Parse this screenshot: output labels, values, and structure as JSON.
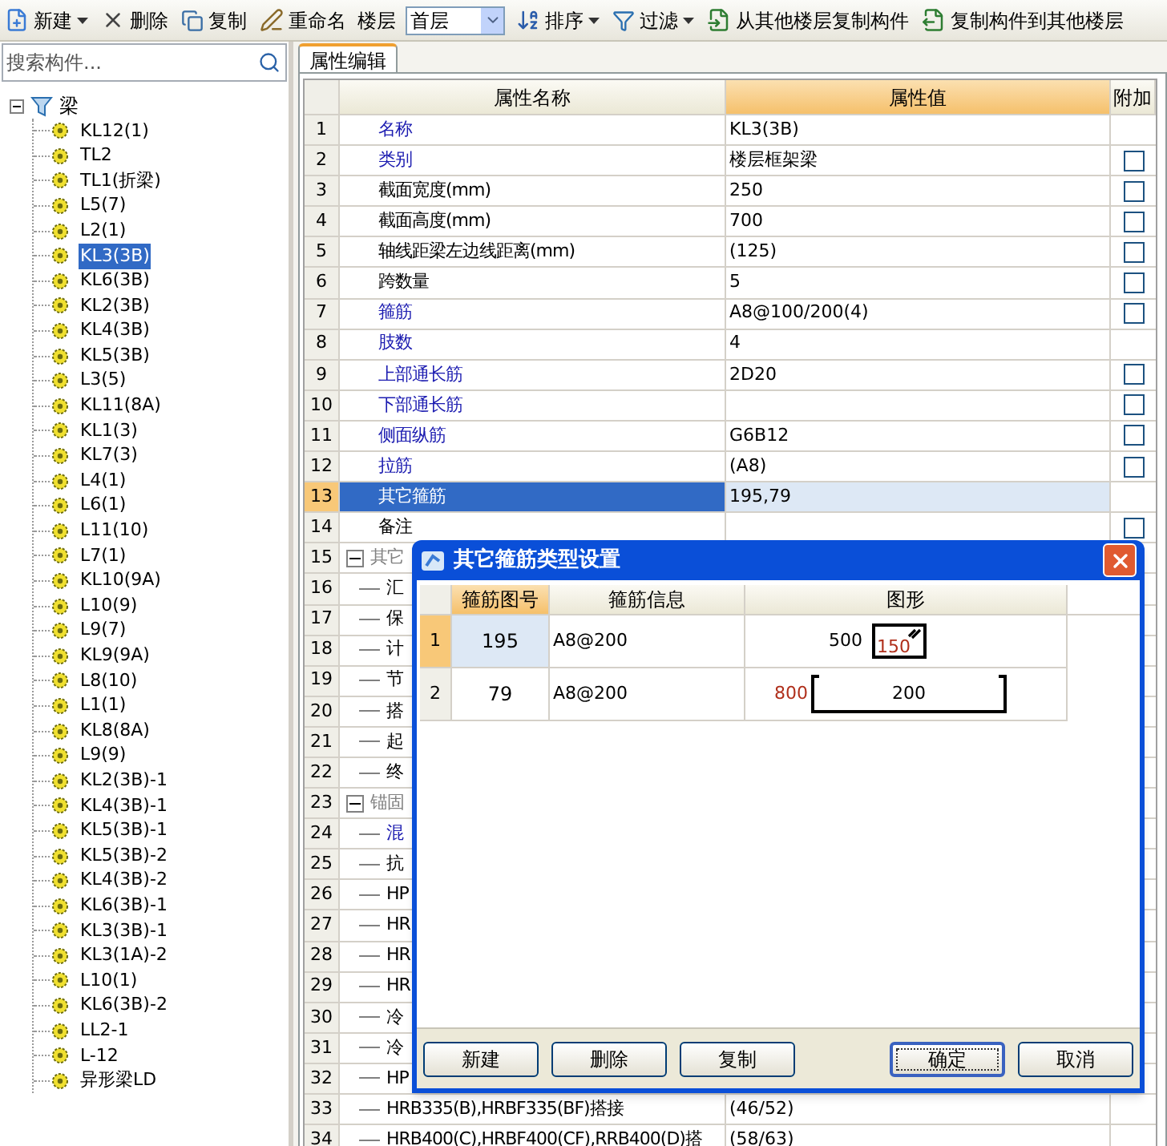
{
  "toolbar": {
    "items": [
      {
        "kind": "button",
        "label": "新建",
        "dropdown": true
      },
      {
        "kind": "button",
        "label": "删除",
        "dropdown": false
      },
      {
        "kind": "button",
        "label": "复制",
        "dropdown": false
      },
      {
        "kind": "button",
        "label": "重命名",
        "dropdown": false
      },
      {
        "kind": "label",
        "label": "楼层"
      },
      {
        "kind": "select",
        "value": "首层"
      },
      {
        "kind": "button",
        "label": "排序",
        "dropdown": true
      },
      {
        "kind": "button",
        "label": "过滤",
        "dropdown": true
      },
      {
        "kind": "button",
        "label": "从其他楼层复制构件",
        "dropdown": false
      },
      {
        "kind": "button",
        "label": "复制构件到其他楼层",
        "dropdown": false
      }
    ]
  },
  "search": {
    "placeholder": "搜索构件..."
  },
  "tree": {
    "root": {
      "label": "梁",
      "expanded": true
    },
    "items": [
      {
        "label": "KL12(1)",
        "selected": false
      },
      {
        "label": "TL2",
        "selected": false
      },
      {
        "label": "TL1(折梁)",
        "selected": false
      },
      {
        "label": "L5(7)",
        "selected": false
      },
      {
        "label": "L2(1)",
        "selected": false
      },
      {
        "label": "KL3(3B)",
        "selected": true
      },
      {
        "label": "KL6(3B)",
        "selected": false
      },
      {
        "label": "KL2(3B)",
        "selected": false
      },
      {
        "label": "KL4(3B)",
        "selected": false
      },
      {
        "label": "KL5(3B)",
        "selected": false
      },
      {
        "label": "L3(5)",
        "selected": false
      },
      {
        "label": "KL11(8A)",
        "selected": false
      },
      {
        "label": "KL1(3)",
        "selected": false
      },
      {
        "label": "KL7(3)",
        "selected": false
      },
      {
        "label": "L4(1)",
        "selected": false
      },
      {
        "label": "L6(1)",
        "selected": false
      },
      {
        "label": "L11(10)",
        "selected": false
      },
      {
        "label": "L7(1)",
        "selected": false
      },
      {
        "label": "KL10(9A)",
        "selected": false
      },
      {
        "label": "L10(9)",
        "selected": false
      },
      {
        "label": "L9(7)",
        "selected": false
      },
      {
        "label": "KL9(9A)",
        "selected": false
      },
      {
        "label": "L8(10)",
        "selected": false
      },
      {
        "label": "L1(1)",
        "selected": false
      },
      {
        "label": "KL8(8A)",
        "selected": false
      },
      {
        "label": "L9(9)",
        "selected": false
      },
      {
        "label": "KL2(3B)-1",
        "selected": false
      },
      {
        "label": "KL4(3B)-1",
        "selected": false
      },
      {
        "label": "KL5(3B)-1",
        "selected": false
      },
      {
        "label": "KL5(3B)-2",
        "selected": false
      },
      {
        "label": "KL4(3B)-2",
        "selected": false
      },
      {
        "label": "KL6(3B)-1",
        "selected": false
      },
      {
        "label": "KL3(3B)-1",
        "selected": false
      },
      {
        "label": "KL3(1A)-2",
        "selected": false
      },
      {
        "label": "L10(1)",
        "selected": false
      },
      {
        "label": "KL6(3B)-2",
        "selected": false
      },
      {
        "label": "LL2-1",
        "selected": false
      },
      {
        "label": "L-12",
        "selected": false
      },
      {
        "label": "异形梁LD",
        "selected": false
      }
    ]
  },
  "tabs": [
    {
      "label": "属性编辑",
      "selected": true
    }
  ],
  "table": {
    "columns": [
      {
        "label": "属性名称",
        "selected": false
      },
      {
        "label": "属性值",
        "selected": true
      },
      {
        "label": "附加",
        "selected": false
      }
    ],
    "rows": [
      {
        "num": "1",
        "name": "名称",
        "value": "KL3(3B)",
        "linked": true,
        "selected": false
      },
      {
        "num": "2",
        "name": "类别",
        "value": "楼层框架梁",
        "linked": true,
        "checked": false,
        "selected": false
      },
      {
        "num": "3",
        "name": "截面宽度(mm)",
        "value": "250",
        "linked": false,
        "checked": false,
        "selected": false
      },
      {
        "num": "4",
        "name": "截面高度(mm)",
        "value": "700",
        "linked": false,
        "checked": false,
        "selected": false
      },
      {
        "num": "5",
        "name": "轴线距梁左边线距离(mm)",
        "value": "(125)",
        "linked": false,
        "checked": false,
        "selected": false
      },
      {
        "num": "6",
        "name": "跨数量",
        "value": "5",
        "linked": false,
        "checked": false,
        "selected": false
      },
      {
        "num": "7",
        "name": "箍筋",
        "value": "A8@100/200(4)",
        "linked": true,
        "checked": false,
        "selected": false
      },
      {
        "num": "8",
        "name": "肢数",
        "value": "4",
        "linked": true,
        "selected": false
      },
      {
        "num": "9",
        "name": "上部通长筋",
        "value": "2D20",
        "linked": true,
        "checked": false,
        "selected": false
      },
      {
        "num": "10",
        "name": "下部通长筋",
        "linked": true,
        "checked": false,
        "selected": false
      },
      {
        "num": "11",
        "name": "侧面纵筋",
        "value": "G6B12",
        "linked": true,
        "checked": false,
        "selected": false
      },
      {
        "num": "12",
        "name": "拉筋",
        "value": "(A8)",
        "linked": true,
        "checked": false,
        "selected": false
      },
      {
        "num": "13",
        "name": "其它箍筋",
        "value": "195,79",
        "linked": false,
        "selected": true
      },
      {
        "num": "14",
        "name": "备注",
        "linked": false,
        "checked": false,
        "selected": false
      },
      {
        "num": "15",
        "name": "其它",
        "expanded": true,
        "selected": false,
        "children": [
          {
            "num": "16",
            "name": "汇",
            "linked": false,
            "selected": false
          },
          {
            "num": "17",
            "name": "保",
            "linked": false,
            "selected": false
          },
          {
            "num": "18",
            "name": "计",
            "linked": false,
            "selected": false
          },
          {
            "num": "19",
            "name": "节",
            "linked": false,
            "selected": false
          },
          {
            "num": "20",
            "name": "搭",
            "linked": false,
            "selected": false
          },
          {
            "num": "21",
            "name": "起",
            "linked": false,
            "selected": false
          },
          {
            "num": "22",
            "name": "终",
            "linked": false,
            "selected": false
          }
        ]
      },
      {
        "num": "23",
        "name": "锚固",
        "expanded": true,
        "selected": false,
        "children": [
          {
            "num": "24",
            "name": "混",
            "linked": true,
            "selected": false
          },
          {
            "num": "25",
            "name": "抗",
            "linked": false,
            "selected": false
          },
          {
            "num": "26",
            "name": "HP",
            "linked": false,
            "selected": false
          },
          {
            "num": "27",
            "name": "HR",
            "linked": false,
            "selected": false
          },
          {
            "num": "28",
            "name": "HR",
            "linked": false,
            "selected": false
          },
          {
            "num": "29",
            "name": "HR",
            "linked": false,
            "selected": false
          },
          {
            "num": "30",
            "name": "冷",
            "linked": false,
            "selected": false
          },
          {
            "num": "31",
            "name": "冷",
            "linked": false,
            "selected": false
          },
          {
            "num": "32",
            "name": "HP",
            "linked": false,
            "selected": false
          },
          {
            "num": "33",
            "name": "HRB335(B),HRBF335(BF)搭接",
            "value": "(46/52)",
            "linked": false,
            "selected": false
          },
          {
            "num": "34",
            "name": "HRB400(C),HRBF400(CF),RRB400(D)搭",
            "value": "(58/63)",
            "linked": false,
            "selected": false
          }
        ]
      }
    ]
  },
  "dialog": {
    "title": "其它箍筋类型设置",
    "columns": [
      {
        "label": "箍筋图号",
        "selected": true
      },
      {
        "label": "箍筋信息",
        "selected": false
      },
      {
        "label": "图形",
        "selected": false
      }
    ],
    "rows": [
      {
        "num": "1",
        "code": "195",
        "info": "A8@200",
        "selected": true,
        "shape": {
          "kind": "hook_box",
          "side": "500",
          "inner": "150"
        }
      },
      {
        "num": "2",
        "code": "79",
        "info": "A8@200",
        "selected": false,
        "shape": {
          "kind": "channel",
          "side": "800",
          "inner": "200"
        }
      }
    ],
    "buttons": [
      {
        "label": "新建",
        "default": false
      },
      {
        "label": "删除",
        "default": false
      },
      {
        "label": "复制",
        "default": false
      },
      {
        "label": "确定",
        "default": true
      },
      {
        "label": "取消",
        "default": false
      }
    ]
  }
}
